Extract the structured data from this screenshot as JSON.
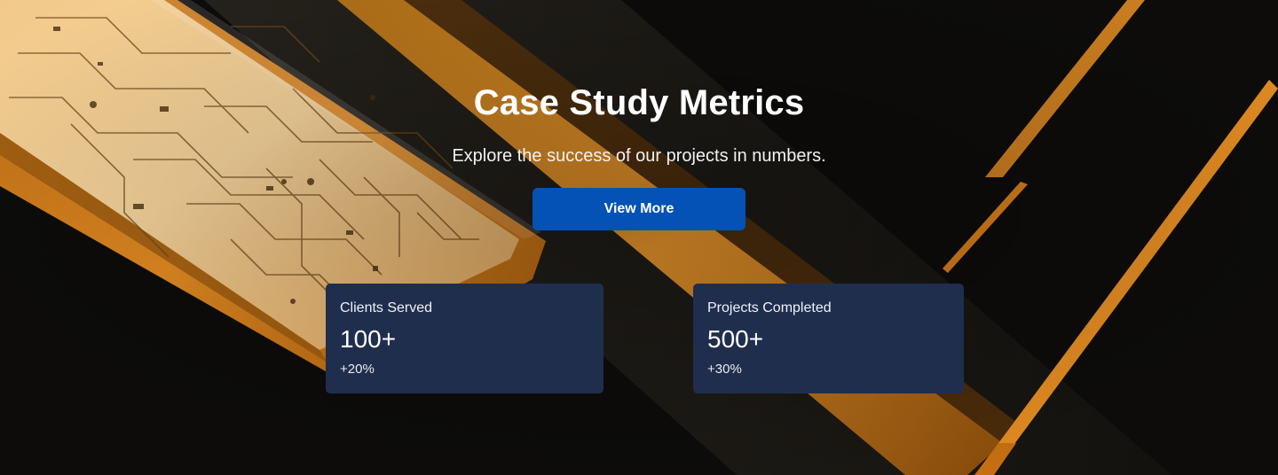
{
  "hero": {
    "title": "Case Study Metrics",
    "subtitle": "Explore the success of our projects in numbers.",
    "cta_label": "View More"
  },
  "metrics": [
    {
      "label": "Clients Served",
      "value": "100+",
      "change": "+20%"
    },
    {
      "label": "Projects Completed",
      "value": "500+",
      "change": "+30%"
    }
  ],
  "colors": {
    "background": "#0c0b09",
    "accent_orange": "#e0861e",
    "button": "#0452b5",
    "card": "#202e4e"
  }
}
